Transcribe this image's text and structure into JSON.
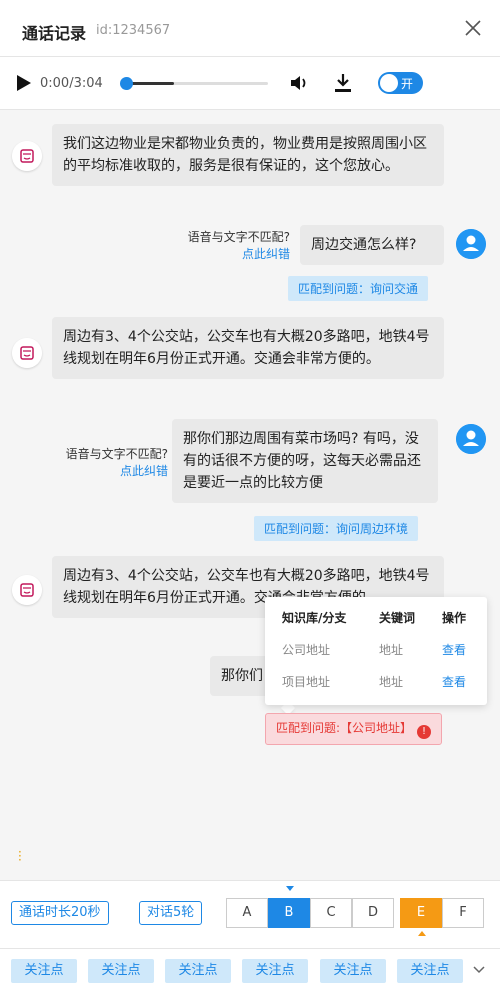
{
  "header": {
    "title": "通话记录",
    "id_text": "id:1234567"
  },
  "player": {
    "time": "0:00/3:04",
    "progress": 0.0,
    "toggle_label": "开"
  },
  "messages": [
    {
      "text": "我们这边物业是宋都物业负责的，物业费用是按照周围小区的平均标准收取的，服务是很有保证的，这个您放心。"
    },
    {
      "text": "周边交通怎么样?",
      "mismatch": "语音与文字不匹配?",
      "fix": "点此纠错",
      "match": "匹配到问题：询问交通"
    },
    {
      "text": "周边有3、4个公交站，公交车也有大概20多路吧，地铁4号线规划在明年6月份正式开通。交通会非常方便的。"
    },
    {
      "text": "那你们那边周围有菜市场吗? 有吗，没有的话很不方便的呀，这每天必需品还是要近一点的比较方便",
      "mismatch": "语音与文字不匹配?",
      "fix": "点此纠错",
      "match": "匹配到问题：询问周边环境"
    },
    {
      "text": "周边有3、4个公交站，公交车也有大概20多路吧，地铁4号线规划在明年6月份正式开通。交通会非常方便的。"
    },
    {
      "text": "那你们",
      "match": "匹配到问题:【公司地址】"
    }
  ],
  "popup": {
    "headers": [
      "知识库/分支",
      "关键词",
      "操作"
    ],
    "rows": [
      [
        "公司地址",
        "地址",
        "查看"
      ],
      [
        "项目地址",
        "地址",
        "查看"
      ]
    ]
  },
  "bottom": {
    "duration": "通话时长20秒",
    "rounds": "对话5轮",
    "grades": [
      "A",
      "B",
      "C",
      "D",
      "E",
      "F"
    ],
    "focus": [
      "关注点",
      "关注点",
      "关注点",
      "关注点",
      "关注点",
      "关注点"
    ]
  },
  "colors": {
    "accent": "#1e88e5",
    "orange": "#f59a14",
    "error": "#e53935"
  },
  "icons": [
    "close-icon",
    "play-icon",
    "volume-icon",
    "download-icon",
    "bot-avatar-icon",
    "user-avatar-icon",
    "alert-icon",
    "chevron-down-icon"
  ]
}
